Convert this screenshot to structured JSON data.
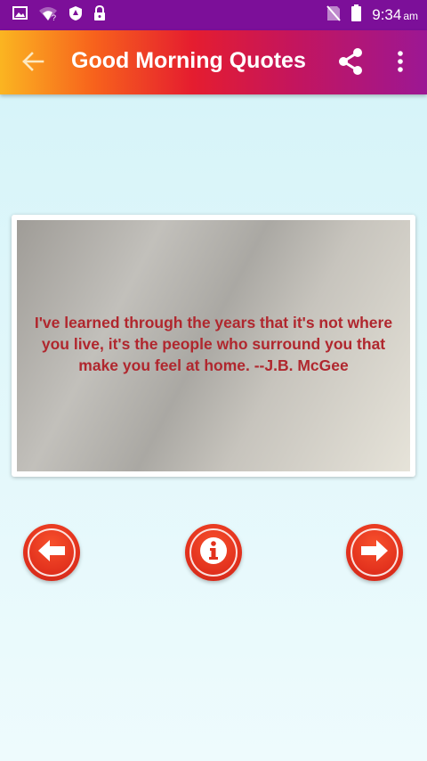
{
  "status_bar": {
    "time": "9:34",
    "ampm": "am",
    "icons": [
      "image-icon",
      "wifi-question-icon",
      "shield-icon",
      "lock-icon",
      "no-sim-icon",
      "battery-icon"
    ]
  },
  "app_bar": {
    "title": "Good Morning Quotes",
    "icons": [
      "back-arrow-icon",
      "share-icon",
      "more-vert-icon"
    ]
  },
  "quote": {
    "text": "I've learned through the years that it's not where you live, it's the people who surround you that make you feel at home. --J.B. McGee"
  },
  "controls": {
    "icons": [
      "arrow-left-icon",
      "info-icon",
      "arrow-right-icon"
    ]
  },
  "colors": {
    "status_bar": "#7c0f99",
    "gradient_start": "#fbb521",
    "gradient_mid": "#e51d2f",
    "gradient_end": "#9c1794",
    "quote_text": "#b0272e",
    "button_red": "#e2311d"
  }
}
